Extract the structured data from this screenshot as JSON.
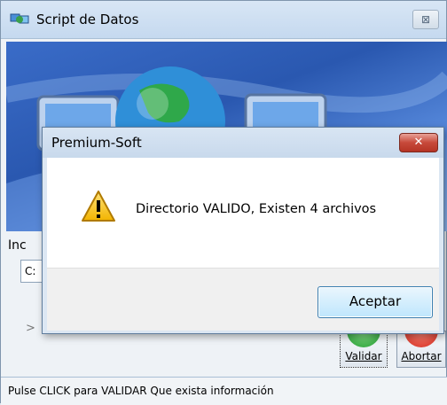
{
  "main_window": {
    "title": "Script de Datos",
    "close_label": "⊠",
    "label_partial": "Inc",
    "input_value": "C:",
    "arrow_text": ">",
    "validar_label": "Validar",
    "abortar_label": "Abortar",
    "status_text": "Pulse CLICK para VALIDAR Que exista información"
  },
  "dialog": {
    "title": "Premium-Soft",
    "close_label": "✕",
    "message": "Directorio VALIDO, Existen 4 archivos",
    "accept_label": "Aceptar"
  },
  "colors": {
    "banner": "#2a58b0",
    "dialog_close": "#c7493a",
    "accept_border": "#3c7fb1"
  }
}
